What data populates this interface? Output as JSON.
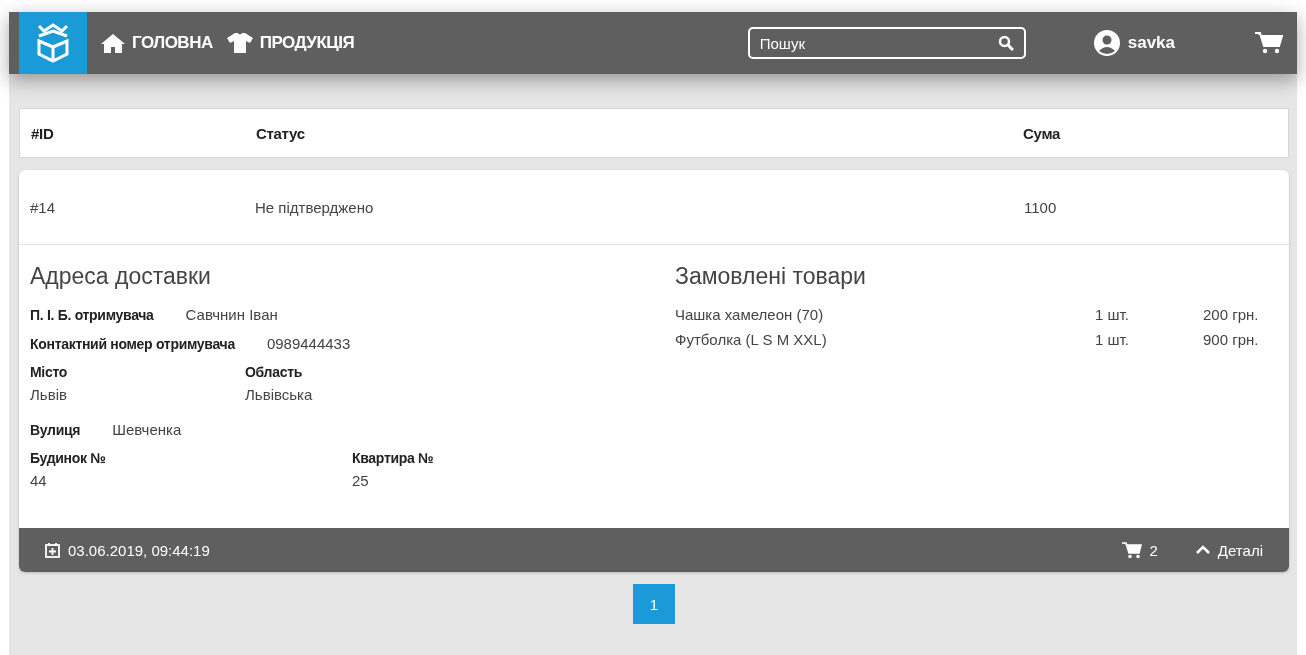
{
  "header": {
    "nav": [
      {
        "label": "ГОЛОВНА",
        "kind": "home"
      },
      {
        "label": "ПРОДУКЦІЯ",
        "kind": "shirt"
      }
    ],
    "search": {
      "placeholder": "Пошук"
    },
    "user": "savka"
  },
  "table": {
    "columns": [
      "#ID",
      "Статус",
      "Сума"
    ]
  },
  "orders": [
    {
      "id": "#14",
      "status": "Не підтверджено",
      "sum": "1100",
      "expanded": true,
      "address": {
        "title": "Адреса доставки",
        "rows": [
          {
            "kind": "inline",
            "label": "П. І. Б. отримувача",
            "value": "Савчнин Іван"
          },
          {
            "kind": "inline",
            "label": "Контактний номер отримувача",
            "value": "0989444433"
          },
          {
            "kind": "stacked",
            "cells": [
              {
                "label": "Місто",
                "value": "Львів"
              },
              {
                "label": "Область",
                "value": "Львівська"
              }
            ]
          },
          {
            "kind": "inline",
            "label": "Вулиця",
            "value": "Шевченка"
          },
          {
            "kind": "stacked",
            "cells": [
              {
                "label": "Будинок №",
                "value": "44"
              },
              {
                "label": "Квартира №",
                "value": "25"
              }
            ]
          }
        ]
      },
      "goods": {
        "title": "Замовлені товари",
        "items": [
          {
            "name": "Чашка хамелеон (70)",
            "qty": "1 шт.",
            "price": "200 грн."
          },
          {
            "name": "Футболка (L S M XXL)",
            "qty": "1 шт.",
            "price": "900 грн."
          }
        ]
      },
      "date": "03.06.2019, 09:44:19",
      "count": "2",
      "details": "Деталі"
    }
  ],
  "pages": [
    {
      "label": "1",
      "selected": true
    }
  ]
}
